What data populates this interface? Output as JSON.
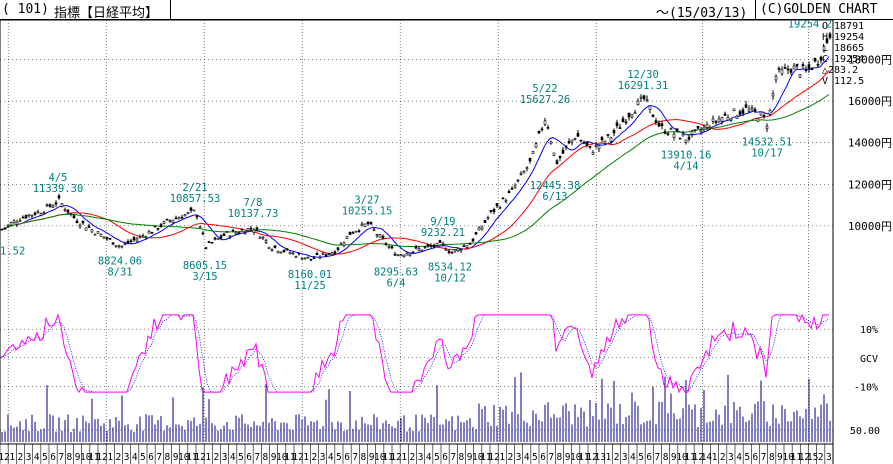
{
  "header": {
    "code": "( 101)",
    "name": "指標【日経平均】",
    "date": "～(15/03/13)",
    "brand": "(C)GOLDEN CHART"
  },
  "ohlc_panel": {
    "open": "O 18791",
    "high": "H 19254",
    "low": "L 18665",
    "close": "C 19254",
    "change": "△283.2",
    "volume": "V 112.5"
  },
  "colors": {
    "candle": "#000000",
    "ma_short": "#0000ff",
    "ma_mid": "#ff0000",
    "ma_long": "#008000",
    "oscillator": "#ff00ff",
    "oscillator_signal": "#0000ff",
    "annotation": "#008080",
    "volume": "#000080",
    "grid": "#000000"
  },
  "chart_data": {
    "type": "candlestick",
    "price_axis": {
      "ticks": [
        {
          "value": 10000,
          "label": "10000円"
        },
        {
          "value": 12000,
          "label": "12000円"
        },
        {
          "value": 14000,
          "label": "14000円"
        },
        {
          "value": 16000,
          "label": "16000円"
        },
        {
          "value": 18000,
          "label": "18000円"
        }
      ],
      "ylim": [
        7300,
        19900
      ]
    },
    "oscillator_axis": {
      "name": "GCV",
      "ticks": [
        {
          "value": 10,
          "label": "10%"
        },
        {
          "value": 0,
          "label": "GCV"
        },
        {
          "value": -10,
          "label": "-10%"
        }
      ],
      "ylim": [
        -13,
        16
      ]
    },
    "volume_axis": {
      "ticks": [
        {
          "value": 50,
          "label": "50.00"
        }
      ]
    },
    "months": [
      "12",
      "1",
      "2",
      "3",
      "4",
      "5",
      "6",
      "7",
      "8",
      "9",
      "10",
      "11",
      "12",
      "1",
      "2",
      "3",
      "4",
      "5",
      "6",
      "7",
      "8",
      "9",
      "10",
      "11",
      "12",
      "1",
      "2",
      "3",
      "4",
      "5",
      "6",
      "7",
      "8",
      "9",
      "10",
      "11",
      "12",
      "1",
      "2",
      "3",
      "4",
      "5",
      "6",
      "7",
      "8",
      "9",
      "10",
      "11",
      "12",
      "1",
      "2",
      "3",
      "4",
      "5",
      "6",
      "7",
      "8",
      "9",
      "10",
      "11",
      "12",
      "1",
      "2",
      "3",
      "4",
      "5",
      "6",
      "7",
      "8",
      "9",
      "10",
      "11",
      "12",
      "13",
      "1",
      "2",
      "3",
      "4",
      "5",
      "6",
      "7",
      "8",
      "9",
      "10",
      "11",
      "12",
      "14",
      "1",
      "2",
      "3",
      "4",
      "5",
      "6",
      "7",
      "8",
      "9",
      "10",
      "11",
      "12",
      "15",
      "2",
      "3"
    ],
    "annotations": [
      {
        "date": "",
        "value_label": "1.52",
        "x": 0,
        "y": 9300
      },
      {
        "date": "4/5",
        "value_label": "11339.30",
        "x": 58,
        "y": 11339
      },
      {
        "date": "8/31",
        "value_label": "8824.06",
        "x": 120,
        "y": 8824
      },
      {
        "date": "2/21",
        "value_label": "10857.53",
        "x": 195,
        "y": 10858
      },
      {
        "date": "3/15",
        "value_label": "8605.15",
        "x": 205,
        "y": 8605
      },
      {
        "date": "7/8",
        "value_label": "10137.73",
        "x": 253,
        "y": 10138
      },
      {
        "date": "11/25",
        "value_label": "8160.01",
        "x": 310,
        "y": 8160
      },
      {
        "date": "3/27",
        "value_label": "10255.15",
        "x": 367,
        "y": 10255
      },
      {
        "date": "6/4",
        "value_label": "8295.63",
        "x": 396,
        "y": 8296
      },
      {
        "date": "9/19",
        "value_label": "9232.21",
        "x": 443,
        "y": 9232
      },
      {
        "date": "10/12",
        "value_label": "8534.12",
        "x": 450,
        "y": 8534
      },
      {
        "date": "5/22",
        "value_label": "15627.26",
        "x": 545,
        "y": 15627
      },
      {
        "date": "6/13",
        "value_label": "12445.38",
        "x": 555,
        "y": 12445
      },
      {
        "date": "12/30",
        "value_label": "16291.31",
        "x": 643,
        "y": 16291
      },
      {
        "date": "4/14",
        "value_label": "13910.16",
        "x": 686,
        "y": 13910
      },
      {
        "date": "10/17",
        "value_label": "14532.51",
        "x": 767,
        "y": 14533
      },
      {
        "date": "3/13",
        "value_label": "19254.2",
        "x": 829,
        "y": 19254
      }
    ],
    "key_closes": [
      [
        0,
        9800
      ],
      [
        20,
        10400
      ],
      [
        40,
        10700
      ],
      [
        58,
        11200
      ],
      [
        75,
        10300
      ],
      [
        95,
        9700
      ],
      [
        120,
        9000
      ],
      [
        145,
        9600
      ],
      [
        170,
        10300
      ],
      [
        195,
        10700
      ],
      [
        205,
        9000
      ],
      [
        225,
        9600
      ],
      [
        253,
        9900
      ],
      [
        270,
        9000
      ],
      [
        290,
        8700
      ],
      [
        310,
        8400
      ],
      [
        335,
        8800
      ],
      [
        350,
        9700
      ],
      [
        367,
        10100
      ],
      [
        380,
        9400
      ],
      [
        396,
        8600
      ],
      [
        420,
        8900
      ],
      [
        443,
        9100
      ],
      [
        450,
        8700
      ],
      [
        470,
        9200
      ],
      [
        490,
        10600
      ],
      [
        510,
        11600
      ],
      [
        530,
        13100
      ],
      [
        545,
        15300
      ],
      [
        555,
        13000
      ],
      [
        575,
        14400
      ],
      [
        590,
        13600
      ],
      [
        610,
        14300
      ],
      [
        630,
        15500
      ],
      [
        643,
        16100
      ],
      [
        660,
        14700
      ],
      [
        686,
        14200
      ],
      [
        700,
        14600
      ],
      [
        720,
        15200
      ],
      [
        745,
        15600
      ],
      [
        760,
        15300
      ],
      [
        767,
        14900
      ],
      [
        775,
        17200
      ],
      [
        790,
        17600
      ],
      [
        805,
        17400
      ],
      [
        818,
        18000
      ],
      [
        829,
        19254
      ]
    ]
  }
}
